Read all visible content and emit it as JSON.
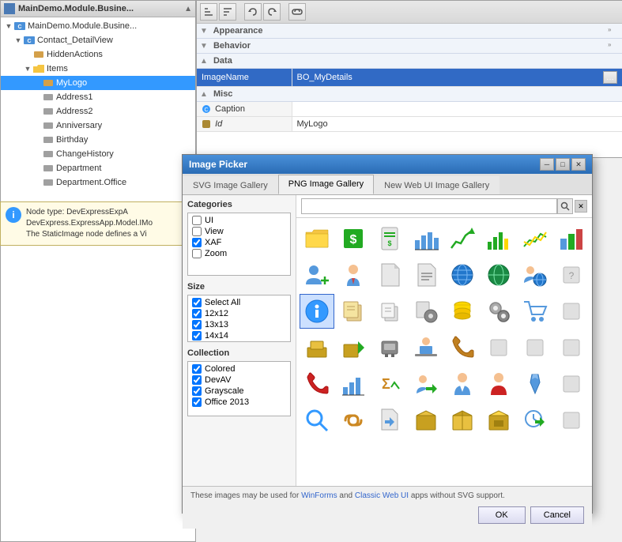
{
  "tree": {
    "title": "MainDemo.Module.Busine...",
    "nodes": [
      {
        "id": "root",
        "label": "MainDemo.Module.Busine...",
        "indent": 1,
        "type": "class",
        "expanded": true
      },
      {
        "id": "contact",
        "label": "Contact_DetailView",
        "indent": 2,
        "type": "class",
        "expanded": true
      },
      {
        "id": "hidden",
        "label": "HiddenActions",
        "indent": 3,
        "type": "item"
      },
      {
        "id": "items",
        "label": "Items",
        "indent": 3,
        "type": "folder",
        "expanded": true
      },
      {
        "id": "mylogo",
        "label": "MyLogo",
        "indent": 4,
        "type": "item",
        "selected": true
      },
      {
        "id": "address1",
        "label": "Address1",
        "indent": 4,
        "type": "item-gray"
      },
      {
        "id": "address2",
        "label": "Address2",
        "indent": 4,
        "type": "item-gray"
      },
      {
        "id": "anniversary",
        "label": "Anniversary",
        "indent": 4,
        "type": "item-gray"
      },
      {
        "id": "birthday",
        "label": "Birthday",
        "indent": 4,
        "type": "item-gray"
      },
      {
        "id": "changehistory",
        "label": "ChangeHistory",
        "indent": 4,
        "type": "item-gray"
      },
      {
        "id": "department",
        "label": "Department",
        "indent": 4,
        "type": "item-gray"
      },
      {
        "id": "dept-office",
        "label": "Department.Office",
        "indent": 4,
        "type": "item-gray"
      }
    ]
  },
  "info": {
    "icon": "i",
    "text": "Node type: DevExpressExpA\nDevExpress.ExpressApp.Model.IMo\nThe StaticImage node defines a Vi"
  },
  "props": {
    "toolbar_buttons": [
      "sort-asc",
      "sort-desc",
      "undo",
      "redo",
      "link"
    ],
    "categories": [
      {
        "name": "Appearance",
        "collapsed": true
      },
      {
        "name": "Behavior",
        "collapsed": true
      },
      {
        "name": "Data",
        "collapsed": false
      },
      {
        "name": "Misc",
        "collapsed": false
      }
    ],
    "rows": [
      {
        "name": "ImageName",
        "value": "BO_MyDetails",
        "selected": true,
        "has_button": true
      },
      {
        "name": "Caption",
        "value": "",
        "selected": false,
        "has_button": false
      },
      {
        "name": "Id",
        "value": "MyLogo",
        "selected": false,
        "is_italic": true
      }
    ]
  },
  "dialog": {
    "title": "Image Picker",
    "tabs": [
      {
        "id": "svg",
        "label": "SVG Image Gallery",
        "active": false
      },
      {
        "id": "png",
        "label": "PNG Image Gallery",
        "active": true
      },
      {
        "id": "webui",
        "label": "New Web UI Image Gallery",
        "active": false
      }
    ],
    "search_placeholder": "",
    "categories_label": "Categories",
    "categories": [
      {
        "label": "UI",
        "checked": false
      },
      {
        "label": "View",
        "checked": false
      },
      {
        "label": "XAF",
        "checked": true
      },
      {
        "label": "Zoom",
        "checked": false
      }
    ],
    "size_label": "Size",
    "sizes": [
      {
        "label": "Select All",
        "checked": true
      },
      {
        "label": "12x12",
        "checked": true
      },
      {
        "label": "13x13",
        "checked": true
      },
      {
        "label": "14x14",
        "checked": true
      }
    ],
    "collection_label": "Collection",
    "collections": [
      {
        "label": "Colored",
        "checked": true
      },
      {
        "label": "DevAV",
        "checked": true
      },
      {
        "label": "Grayscale",
        "checked": true
      },
      {
        "label": "Office 2013",
        "checked": true
      }
    ],
    "footer_note_prefix": "These images may be used for ",
    "footer_note_link1": "WinForms",
    "footer_note_mid": " and ",
    "footer_note_link2": "Classic Web UI",
    "footer_note_suffix": " apps without SVG support.",
    "ok_label": "OK",
    "cancel_label": "Cancel",
    "selected_img": 0,
    "images": [
      {
        "row": 0,
        "col": 0,
        "color": "#c8a020",
        "type": "folder",
        "selected": false
      },
      {
        "row": 0,
        "col": 1,
        "color": "#22aa22",
        "type": "dollar",
        "selected": false
      },
      {
        "row": 0,
        "col": 2,
        "color": "#22aa22",
        "type": "dollardoc",
        "selected": false
      },
      {
        "row": 0,
        "col": 3,
        "color": "#5599dd",
        "type": "chart",
        "selected": false
      },
      {
        "row": 0,
        "col": 4,
        "color": "#22aa22",
        "type": "chartup",
        "selected": false
      },
      {
        "row": 0,
        "col": 5,
        "color": "#22aa22",
        "type": "chartbar",
        "selected": false
      },
      {
        "row": 0,
        "col": 6,
        "color": "#22aa22",
        "type": "chartline",
        "selected": false
      },
      {
        "row": 0,
        "col": 7,
        "color": "#5599dd",
        "type": "chartcolumn",
        "selected": false
      },
      {
        "row": 1,
        "col": 0,
        "color": "#5599dd",
        "type": "person-add",
        "selected": false
      },
      {
        "row": 1,
        "col": 1,
        "color": "#5599dd",
        "type": "person-tie",
        "selected": false
      },
      {
        "row": 1,
        "col": 2,
        "color": "#aaaaaa",
        "type": "doc-blank",
        "selected": false
      },
      {
        "row": 1,
        "col": 3,
        "color": "#aaaaaa",
        "type": "doc-lines",
        "selected": false
      },
      {
        "row": 1,
        "col": 4,
        "color": "#2277cc",
        "type": "globe",
        "selected": false
      },
      {
        "row": 1,
        "col": 5,
        "color": "#2277cc",
        "type": "globe2",
        "selected": false
      },
      {
        "row": 1,
        "col": 6,
        "color": "#5599dd",
        "type": "person-globe",
        "selected": false
      },
      {
        "row": 1,
        "col": 7,
        "color": "#aaaaaa",
        "type": "spacer",
        "selected": false
      },
      {
        "row": 2,
        "col": 0,
        "color": "#3399ff",
        "type": "person-info",
        "selected": true
      },
      {
        "row": 2,
        "col": 1,
        "color": "#c8a020",
        "type": "docs-stack",
        "selected": false
      },
      {
        "row": 2,
        "col": 2,
        "color": "#aaaaaa",
        "type": "docs-copy",
        "selected": false
      },
      {
        "row": 2,
        "col": 3,
        "color": "#aaaaaa",
        "type": "docs-gear",
        "selected": false
      },
      {
        "row": 2,
        "col": 4,
        "color": "#22aa22",
        "type": "coins",
        "selected": false
      },
      {
        "row": 2,
        "col": 5,
        "color": "#aaaaaa",
        "type": "gear-stack",
        "selected": false
      },
      {
        "row": 2,
        "col": 6,
        "color": "#5599dd",
        "type": "cart",
        "selected": false
      },
      {
        "row": 2,
        "col": 7,
        "color": "#aaaaaa",
        "type": "spacer2",
        "selected": false
      },
      {
        "row": 3,
        "col": 0,
        "color": "#c8a020",
        "type": "box-stack",
        "selected": false
      },
      {
        "row": 3,
        "col": 1,
        "color": "#c8a020",
        "type": "box-arrow",
        "selected": false
      },
      {
        "row": 3,
        "col": 2,
        "color": "#aaaaaa",
        "type": "machine",
        "selected": false
      },
      {
        "row": 3,
        "col": 3,
        "color": "#5599dd",
        "type": "person-desk",
        "selected": false
      },
      {
        "row": 3,
        "col": 4,
        "color": "#c08020",
        "type": "phone",
        "selected": false
      },
      {
        "row": 3,
        "col": 5,
        "color": "#aaaaaa",
        "type": "spacer3",
        "selected": false
      },
      {
        "row": 3,
        "col": 6,
        "color": "#aaaaaa",
        "type": "spacer4",
        "selected": false
      },
      {
        "row": 3,
        "col": 7,
        "color": "#aaaaaa",
        "type": "spacer5",
        "selected": false
      },
      {
        "row": 4,
        "col": 0,
        "color": "#cc2222",
        "type": "phone2",
        "selected": false
      },
      {
        "row": 4,
        "col": 1,
        "color": "#5599dd",
        "type": "barchart",
        "selected": false
      },
      {
        "row": 4,
        "col": 2,
        "color": "#cc8822",
        "type": "sigma-chart",
        "selected": false
      },
      {
        "row": 4,
        "col": 3,
        "color": "#5599dd",
        "type": "person-arrow",
        "selected": false
      },
      {
        "row": 4,
        "col": 4,
        "color": "#5599dd",
        "type": "person-suit",
        "selected": false
      },
      {
        "row": 4,
        "col": 5,
        "color": "#cc2222",
        "type": "person-red",
        "selected": false
      },
      {
        "row": 4,
        "col": 6,
        "color": "#5599dd",
        "type": "tie",
        "selected": false
      },
      {
        "row": 4,
        "col": 7,
        "color": "#aaaaaa",
        "type": "spacer6",
        "selected": false
      },
      {
        "row": 5,
        "col": 0,
        "color": "#3399ff",
        "type": "magnifier",
        "selected": false
      },
      {
        "row": 5,
        "col": 1,
        "color": "#cc8822",
        "type": "link2",
        "selected": false
      },
      {
        "row": 5,
        "col": 2,
        "color": "#aaaaaa",
        "type": "doc-arrow",
        "selected": false
      },
      {
        "row": 5,
        "col": 3,
        "color": "#c8a020",
        "type": "box2",
        "selected": false
      },
      {
        "row": 5,
        "col": 4,
        "color": "#c8a020",
        "type": "box3",
        "selected": false
      },
      {
        "row": 5,
        "col": 5,
        "color": "#c8a020",
        "type": "box4",
        "selected": false
      },
      {
        "row": 5,
        "col": 6,
        "color": "#5599dd",
        "type": "clock-arrow",
        "selected": false
      },
      {
        "row": 5,
        "col": 7,
        "color": "#aaaaaa",
        "type": "spacer7",
        "selected": false
      }
    ]
  }
}
